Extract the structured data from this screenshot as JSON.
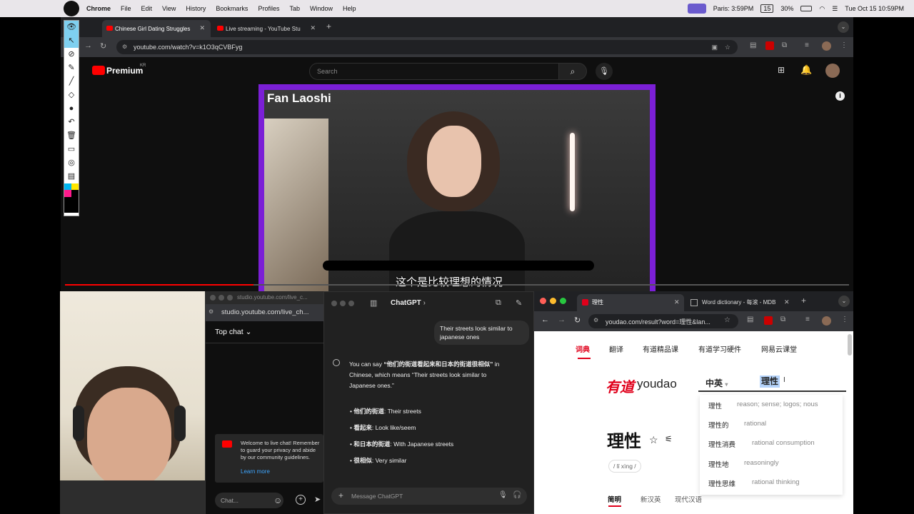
{
  "menubar": {
    "app": "Chrome",
    "items": [
      "File",
      "Edit",
      "View",
      "History",
      "Bookmarks",
      "Profiles",
      "Tab",
      "Window",
      "Help"
    ],
    "clock_label": "Paris: 3:59PM",
    "badge": "15",
    "battery": "30%",
    "datetime": "Tue Oct 15  10:59PM"
  },
  "main_browser": {
    "tabs": [
      "Chinese Girl Dating Struggles",
      "Live streaming - YouTube Stu"
    ],
    "url": "youtube.com/watch?v=k1O3qCVBFyg",
    "logo": "Premium",
    "logo_region": "KR",
    "search_placeholder": "Search",
    "video_label": "Fan Laoshi",
    "subtitle": "这个是比较理想的情况"
  },
  "studio": {
    "url_title": "studio.youtube.com/live_c...",
    "url": "studio.youtube.com/live_ch...",
    "top_chat": "Top chat",
    "welcome": "Welcome to live chat! Remember to guard your privacy and abide by our community guidelines.",
    "learn_more": "Learn more",
    "chat_placeholder": "Chat..."
  },
  "chatgpt": {
    "title": "ChatGPT",
    "user_msg": "Their streets look similar to japanese ones",
    "reply_intro_prefix": "You can say ",
    "reply_quote": "“他们的街道看起来和日本的街道很相似”",
    "reply_intro_suffix": " in Chinese, which means “Their streets look similar to Japanese ones.”",
    "bullets": [
      {
        "zh": "他们的街道",
        "en": ": Their streets"
      },
      {
        "zh": "看起来",
        "en": ": Look like/seem"
      },
      {
        "zh": "和日本的街道",
        "en": ": With Japanese streets"
      },
      {
        "zh": "很相似",
        "en": ": Very similar"
      }
    ],
    "input_placeholder": "Message ChatGPT"
  },
  "youdao": {
    "tabs": [
      "理性",
      "Word dictionary - 每滚 - MDB"
    ],
    "url": "youdao.com/result?word=理性&lan...",
    "nav": [
      "词典",
      "翻译",
      "有道精品课",
      "有道学习硬件",
      "网易云课堂"
    ],
    "logo_cn": "有道",
    "logo_en": "youdao",
    "lang": "中英",
    "query": "理性",
    "headword": "理性",
    "pinyin": "/ lǐ xìng /",
    "suggestions": [
      {
        "zh": "理性",
        "en": "reason; sense; logos; nous"
      },
      {
        "zh": "理性的",
        "en": "rational"
      },
      {
        "zh": "理性消费",
        "en": "rational consumption"
      },
      {
        "zh": "理性地",
        "en": "reasoningly"
      },
      {
        "zh": "理性思维",
        "en": "rational thinking"
      }
    ],
    "bottom_tabs": [
      "简明",
      "新汉英",
      "现代汉语"
    ]
  }
}
